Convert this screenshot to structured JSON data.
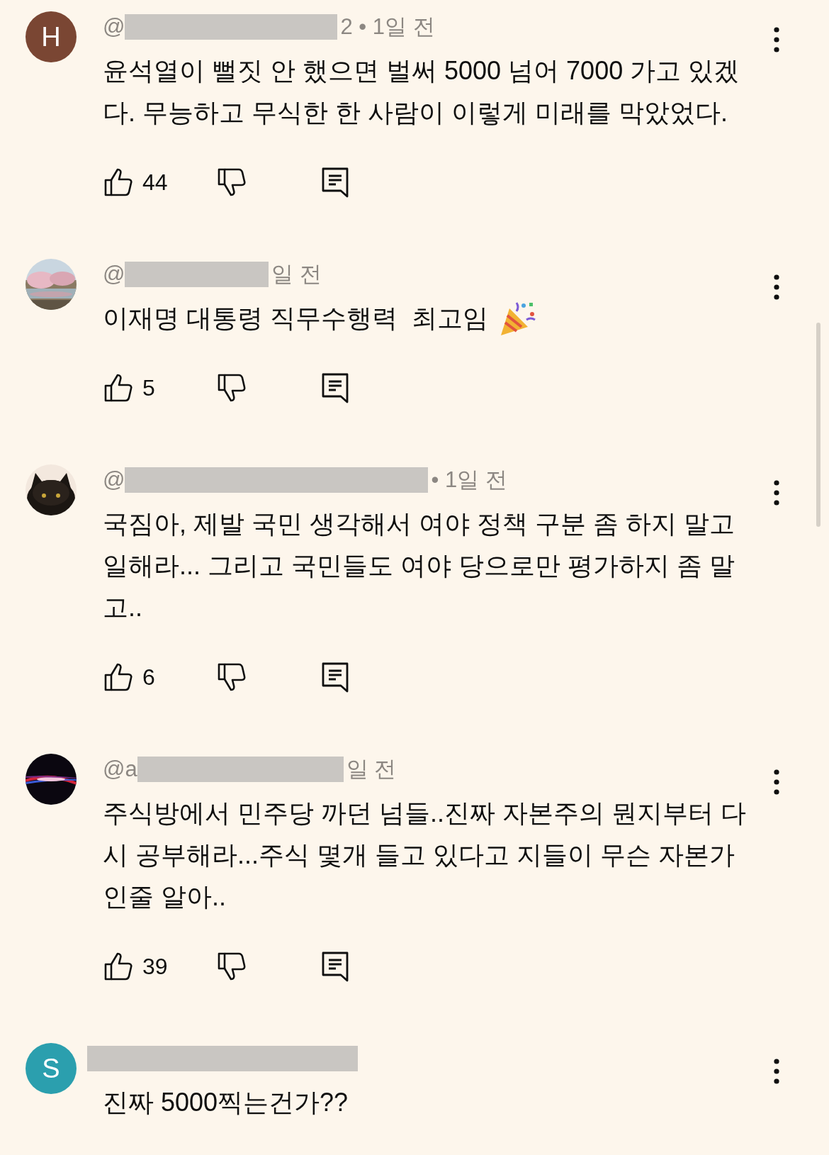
{
  "comments": [
    {
      "avatar": {
        "kind": "letter",
        "letter": "H",
        "color": "#7a4633"
      },
      "author_prefix": "@",
      "author_suffix": "2 • 1일 전",
      "text": "윤석열이 뻘짓 안 했으면 벌써 5000 넘어 7000 가고 있겠다. 무능하고 무식한 한 사람이 이렇게 미래를 막았었다.",
      "likes": "44"
    },
    {
      "author_prefix": "@",
      "author_suffix": "일 전",
      "text": "이재명 대통령 직무수행력  최고임",
      "party_icon": true,
      "likes": "5"
    },
    {
      "author_prefix": "@",
      "author_suffix": "• 1일 전",
      "text": "국짐아, 제발 국민 생각해서 여야 정책 구분 좀 하지 말고 일해라... 그리고 국민들도 여야 당으로만 평가하지 좀 말고..",
      "likes": "6"
    },
    {
      "author_prefix": "@a",
      "author_suffix": "일 전",
      "text": "주식방에서 민주당 까던 넘들..진짜 자본주의 뭔지부터 다시 공부해라...주식 몇개 들고 있다고 지들이 무슨 자본가 인줄 알아..",
      "likes": "39"
    },
    {
      "avatar": {
        "kind": "letter",
        "letter": "S",
        "color": "#2b9fae"
      },
      "text": "진짜 5000찍는건가??"
    }
  ]
}
